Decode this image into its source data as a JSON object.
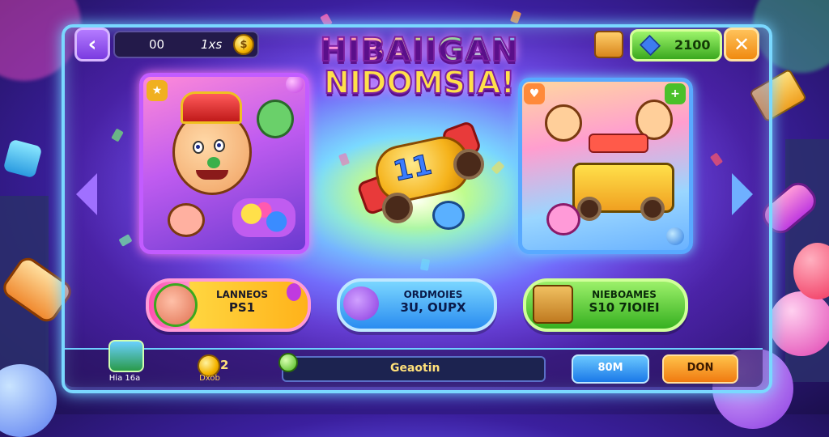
{
  "header": {
    "stat_value_1": "00",
    "stat_value_2": "1xs",
    "gem_count": "2100",
    "close_glyph": "✕",
    "back_glyph": "‹"
  },
  "title": {
    "line1": "HIBAIIGAN",
    "line2": "NIDOMSIA!"
  },
  "center": {
    "car_number": "11"
  },
  "buttons": {
    "left": {
      "line1": "LANNEOS",
      "line2": "PS1"
    },
    "middle": {
      "line1": "ORDMOIES",
      "line2": "3U, OUPX"
    },
    "right": {
      "line1": "NIEBOAMES",
      "line2": "S10 7IOIEI"
    }
  },
  "bottom": {
    "item1_label": "Hia 16a",
    "coin_count": "2",
    "coin_label": "Dxob",
    "search_text": "Geaotin",
    "blue_button": "80M",
    "orange_button": "DON"
  },
  "colors": {
    "frame": "#7ad8ff",
    "left_card_border": "#c25cff",
    "right_card_border": "#59a9ff",
    "gem_bar": "#3aa81e",
    "close_button": "#f08a10"
  }
}
